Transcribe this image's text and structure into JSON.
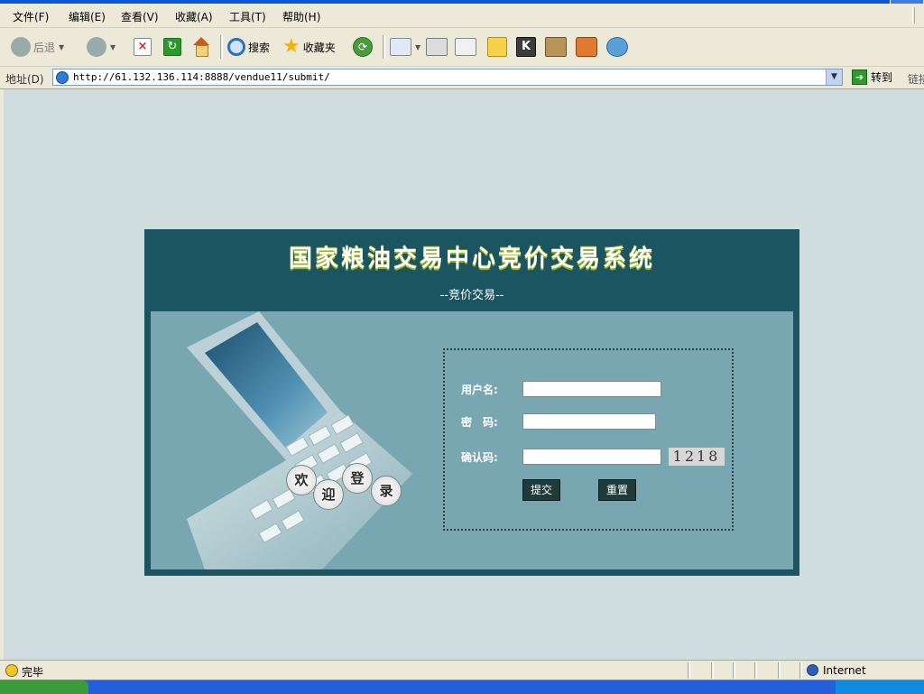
{
  "menubar": {
    "items": [
      "文件(F)",
      "编辑(E)",
      "查看(V)",
      "收藏(A)",
      "工具(T)",
      "帮助(H)"
    ]
  },
  "toolbar": {
    "back_label": "后退",
    "search_label": "搜索",
    "favorites_label": "收藏夹"
  },
  "addressbar": {
    "label": "地址(D)",
    "url": "http://61.132.136.114:8888/vendue11/submit/",
    "go_label": "转到",
    "links_label": "链接"
  },
  "page": {
    "title": "国家粮油交易中心竞价交易系统",
    "subtitle": "--竞价交易--",
    "welcome_chars": [
      "欢",
      "迎",
      "登",
      "录"
    ],
    "form": {
      "username_label": "用户名:",
      "password_label": "密　码:",
      "confirm_label": "确认码:",
      "username_value": "",
      "password_value": "",
      "confirm_value": "",
      "captcha": "1218",
      "submit_label": "提交",
      "reset_label": "重置"
    }
  },
  "statusbar": {
    "text": "完毕",
    "zone": "Internet"
  },
  "colors": {
    "card_header": "#1b5561",
    "card_body": "#78a6b1",
    "content_bg": "#cfdddf",
    "title_shadow": "#8fb11d",
    "button_bg": "#1f3b39"
  },
  "icons": {
    "back": "back-arrow-icon",
    "forward": "forward-arrow-icon",
    "stop": "stop-icon",
    "refresh": "refresh-icon",
    "home": "home-icon",
    "search": "search-icon",
    "favorites": "star-icon",
    "history": "history-icon",
    "mail": "mail-icon",
    "print": "print-icon",
    "edit": "edit-icon",
    "note": "note-icon",
    "k": "k-icon",
    "book": "book-icon",
    "messenger": "messenger-icon",
    "people": "people-icon",
    "go": "go-arrow-icon",
    "status": "page-done-icon",
    "zone": "internet-globe-icon"
  }
}
